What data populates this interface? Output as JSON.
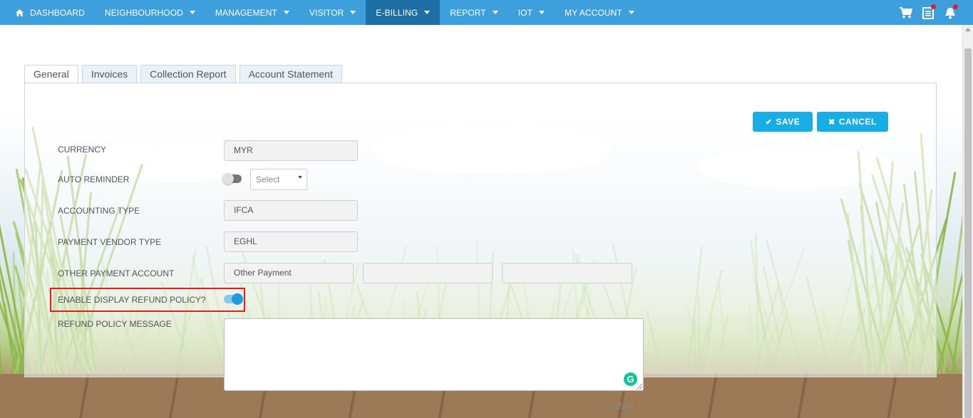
{
  "navbar": {
    "items": [
      {
        "label": "DASHBOARD",
        "has_caret": false,
        "active": false
      },
      {
        "label": "NEIGHBOURHOOD",
        "has_caret": true,
        "active": false
      },
      {
        "label": "MANAGEMENT",
        "has_caret": true,
        "active": false
      },
      {
        "label": "VISITOR",
        "has_caret": true,
        "active": false
      },
      {
        "label": "E-BILLING",
        "has_caret": true,
        "active": true
      },
      {
        "label": "REPORT",
        "has_caret": true,
        "active": false
      },
      {
        "label": "IOT",
        "has_caret": true,
        "active": false
      },
      {
        "label": "MY ACCOUNT",
        "has_caret": true,
        "active": false
      }
    ],
    "right_icons": [
      "cart-icon",
      "document-list-icon",
      "notification-bell-icon"
    ],
    "colors": {
      "bar": "#3d9fdb",
      "active": "#1e6fa6",
      "badge": "#e51c23"
    }
  },
  "tabs": [
    {
      "label": "General",
      "active": true
    },
    {
      "label": "Invoices",
      "active": false
    },
    {
      "label": "Collection Report",
      "active": false
    },
    {
      "label": "Account Statement",
      "active": false
    }
  ],
  "actions": {
    "save_label": "SAVE",
    "cancel_label": "CANCEL",
    "color": "#17aee6"
  },
  "form": {
    "currency": {
      "label": "CURRENCY",
      "value": "MYR"
    },
    "auto_reminder": {
      "label": "AUTO REMINDER",
      "enabled": false,
      "select_placeholder": "Select"
    },
    "accounting_type": {
      "label": "ACCOUNTING TYPE",
      "value": "IFCA"
    },
    "payment_vendor_type": {
      "label": "PAYMENT VENDOR TYPE",
      "value": "EGHL"
    },
    "other_payment_account": {
      "label": "OTHER PAYMENT ACCOUNT",
      "values": [
        "Other Payment",
        "",
        ""
      ]
    },
    "enable_display_refund_policy": {
      "label": "ENABLE DISPLAY REFUND POLICY?",
      "enabled": true
    },
    "refund_policy_message": {
      "label": "REFUND POLICY MESSAGE",
      "value": "",
      "counter": "0/500"
    }
  }
}
